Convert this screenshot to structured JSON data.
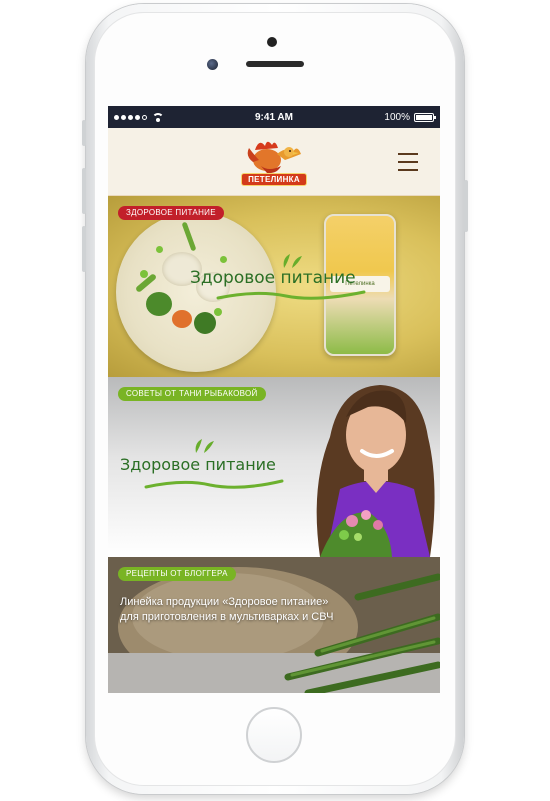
{
  "status_bar": {
    "time": "9:41 AM",
    "battery": "100%",
    "battery_level": 1.0
  },
  "header": {
    "logo_text": "ПЕТЕЛИНКА",
    "menu_icon": "hamburger-menu-icon"
  },
  "banners": [
    {
      "tag": "ЗДОРОВОЕ ПИТАНИЕ",
      "tag_color": "#c21f2a",
      "brand_text": "Здоровое питание"
    },
    {
      "tag": "СОВЕТЫ ОТ ТАНИ РЫБАКОВОЙ",
      "tag_color": "#79b424",
      "brand_text": "Здоровое питание"
    },
    {
      "tag": "РЕЦЕПТЫ ОТ БЛОГГЕРА",
      "tag_color": "#79b424",
      "text_line1": "Линейка продукции «Здоровое питание»",
      "text_line2": "для приготовления в мультиварках и СВЧ"
    }
  ],
  "colors": {
    "status_bar_bg": "#1e2333",
    "header_bg": "#f6f1e6",
    "brand_green": "#2b6f25",
    "accent_red": "#c21f2a",
    "accent_green": "#79b424"
  }
}
